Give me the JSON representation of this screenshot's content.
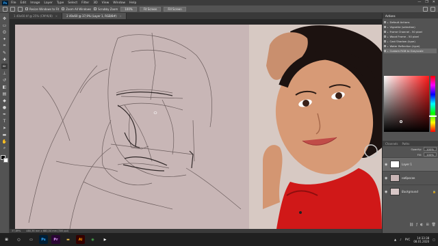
{
  "app": {
    "logo": "Ps",
    "menu": [
      "File",
      "Edit",
      "Image",
      "Layer",
      "Type",
      "Select",
      "Filter",
      "3D",
      "View",
      "Window",
      "Help"
    ],
    "window_controls": [
      "—",
      "❐",
      "✕"
    ]
  },
  "options_bar": {
    "resize_windows": "Resize Windows to Fit",
    "zoom_all": "Zoom All Windows",
    "scrubby_zoom": "Scrubby Zoom",
    "btn_100": "100%",
    "btn_fit": "Fit Screen",
    "btn_fill": "Fill Screen"
  },
  "tabs": [
    {
      "label": "1 40x60.tif @ 25% (CMYK/8)",
      "active": false
    },
    {
      "label": "2 40x60 @ 37,9% (Layer 1, RGB/8#)",
      "active": true
    }
  ],
  "tools": [
    "move-icon",
    "marquee-icon",
    "lasso-icon",
    "wand-icon",
    "crop-icon",
    "eyedropper-icon",
    "heal-icon",
    "brush-icon",
    "stamp-icon",
    "history-brush-icon",
    "eraser-icon",
    "gradient-icon",
    "blur-icon",
    "dodge-icon",
    "pen-icon",
    "type-icon",
    "path-select-icon",
    "shape-icon",
    "hand-icon",
    "zoom-icon"
  ],
  "status": {
    "zoom": "37,89%",
    "doc": "480,36 mm x 680,04 mm (300 ppi)"
  },
  "actions_panel": {
    "title": "Actions",
    "items": [
      {
        "label": "Default Actions",
        "selected": false
      },
      {
        "label": "Vignette (selection)",
        "selected": false
      },
      {
        "label": "Frame Channel - 50 pixel",
        "selected": false
      },
      {
        "label": "Wood Frame - 50 pixel",
        "selected": false
      },
      {
        "label": "Cast Shadow (type)",
        "selected": false
      },
      {
        "label": "Water Reflection (type)",
        "selected": false
      },
      {
        "label": "Custom RGB to Grayscale",
        "selected": true
      }
    ]
  },
  "layers_panel": {
    "tabs": [
      "Channels",
      "Paths"
    ],
    "opacity_label": "Opacity:",
    "opacity_value": "100%",
    "fill_label": "Fill:",
    "fill_value": "100%",
    "layers": [
      {
        "name": "Layer 1",
        "selected": true,
        "thumb": "white"
      },
      {
        "name": "набросок",
        "selected": false,
        "thumb": "pink"
      },
      {
        "name": "Background",
        "selected": false,
        "thumb": "bgfill"
      }
    ]
  },
  "taskbar": {
    "apps": [
      {
        "icon": "windows-icon",
        "label": "⊞",
        "bg": "#202020",
        "fg": "#ffffff"
      },
      {
        "icon": "search-icon",
        "label": "○",
        "bg": "#202020",
        "fg": "#ffffff"
      },
      {
        "icon": "taskview-icon",
        "label": "▭",
        "bg": "#202020",
        "fg": "#ffffff"
      },
      {
        "icon": "photoshop-icon",
        "label": "Ps",
        "bg": "#001e36",
        "fg": "#31a8ff"
      },
      {
        "icon": "premiere-icon",
        "label": "Pr",
        "bg": "#2a0634",
        "fg": "#e29bff"
      },
      {
        "icon": "explorer-icon",
        "label": "▬",
        "bg": "#202020",
        "fg": "#f2c14e"
      },
      {
        "icon": "illustrator-icon",
        "label": "Ai",
        "bg": "#330000",
        "fg": "#ff9a00"
      },
      {
        "icon": "chrome-icon",
        "label": "◉",
        "bg": "#202020",
        "fg": "#4caf50"
      },
      {
        "icon": "media-icon",
        "label": "▶",
        "bg": "#202020",
        "fg": "#ffffff"
      }
    ],
    "lang": "РУС",
    "time": "14:33:38",
    "date": "08.01.2020"
  },
  "colors": {
    "canvas": "#c8b6b6",
    "accent": "#31a8ff",
    "shirt": "#d01818"
  }
}
